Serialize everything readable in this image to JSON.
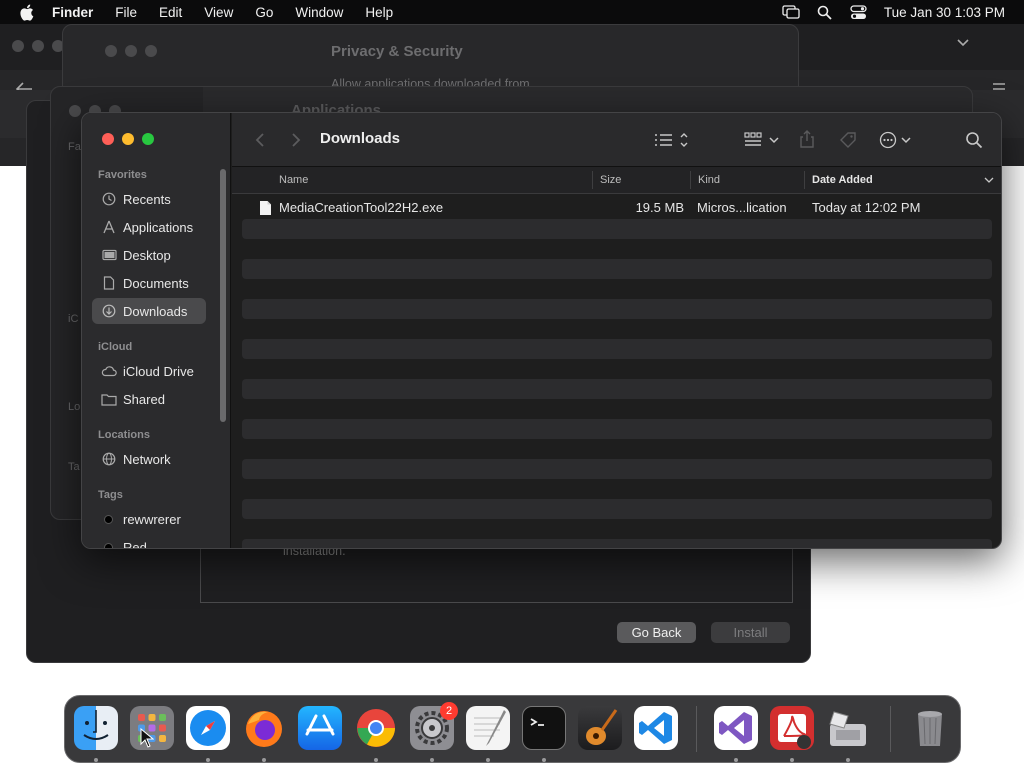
{
  "menubar": {
    "app_name": "Finder",
    "menus": [
      "File",
      "Edit",
      "View",
      "Go",
      "Window",
      "Help"
    ],
    "clock": "Tue Jan 30  1:03 PM"
  },
  "background": {
    "settings_title": "Privacy & Security",
    "settings_subtitle": "Allow applications downloaded from",
    "applications_title": "Applications",
    "installer_text": "installation.",
    "go_back_label": "Go Back",
    "install_label": "Install",
    "ghost_labels": [
      "Fa",
      "iC",
      "Lo",
      "Ta"
    ]
  },
  "finder": {
    "title": "Downloads",
    "sidebar": {
      "favorites_header": "Favorites",
      "favorites": [
        {
          "label": "Recents",
          "icon": "clock-icon"
        },
        {
          "label": "Applications",
          "icon": "applications-icon"
        },
        {
          "label": "Desktop",
          "icon": "desktop-icon"
        },
        {
          "label": "Documents",
          "icon": "document-icon"
        },
        {
          "label": "Downloads",
          "icon": "download-icon"
        }
      ],
      "icloud_header": "iCloud",
      "icloud": [
        {
          "label": "iCloud Drive",
          "icon": "cloud-icon"
        },
        {
          "label": "Shared",
          "icon": "shared-folder-icon"
        }
      ],
      "locations_header": "Locations",
      "locations": [
        {
          "label": "Network",
          "icon": "globe-icon"
        }
      ],
      "tags_header": "Tags",
      "tags": [
        {
          "label": "rewwrerer",
          "color": "#000000"
        },
        {
          "label": "Red",
          "color": "#000000"
        }
      ]
    },
    "columns": {
      "name": "Name",
      "size": "Size",
      "kind": "Kind",
      "date_added": "Date Added"
    },
    "files": [
      {
        "name": "MediaCreationTool22H2.exe",
        "size": "19.5 MB",
        "kind": "Micros...lication",
        "date_added": "Today at 12:02 PM"
      }
    ]
  },
  "dock": {
    "apps": [
      "Finder",
      "Launchpad",
      "Safari",
      "Firefox",
      "App Store",
      "Chrome",
      "System Settings",
      "TextEdit",
      "Terminal",
      "GarageBand",
      "Visual Studio Code",
      "Visual Studio",
      "Acrobat",
      "Boot Camp Assistant",
      "Trash"
    ],
    "settings_badge": "2"
  },
  "colors": {
    "close": "#ff5f57",
    "minimize": "#febc2e",
    "zoom": "#28c840",
    "badge": "#ff3b30"
  }
}
